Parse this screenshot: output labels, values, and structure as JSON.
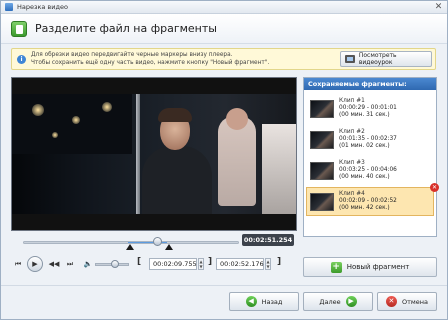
{
  "window": {
    "title": "Нарезка видео",
    "close_glyph": "✕"
  },
  "header": {
    "title": "Разделите файл на фрагменты"
  },
  "hint": {
    "line1": "Для обрезки видео передвигайте черные маркеры внизу плеера.",
    "line2": "Чтобы сохранить ещё одну часть видео, нажмите кнопку \"Новый фрагмент\".",
    "tutorial_label": "Посмотреть видеоурок"
  },
  "player": {
    "current_time": "00:02:51.254",
    "progress": 0.62,
    "start_field": "00:02:09.755",
    "end_field": "00:02:52.176",
    "volume": 0.6
  },
  "clips": {
    "header": "Сохраняемые фрагменты:",
    "items": [
      {
        "name": "Клип #1",
        "range": "00:00:29 - 00:01:01",
        "duration": "(00 мин. 31 сек.)",
        "active": false
      },
      {
        "name": "Клип #2",
        "range": "00:01:35 - 00:02:37",
        "duration": "(01 мин. 02 сек.)",
        "active": false
      },
      {
        "name": "Клип #3",
        "range": "00:03:25 - 00:04:06",
        "duration": "(00 мин. 40 сек.)",
        "active": false
      },
      {
        "name": "Клип #4",
        "range": "00:02:09 - 00:02:52",
        "duration": "(00 мин. 42 сек.)",
        "active": true
      }
    ],
    "new_clip_label": "Новый фрагмент"
  },
  "footer": {
    "back_label": "Назад",
    "next_label": "Далее",
    "cancel_label": "Отмена"
  },
  "colors": {
    "accent": "#2f69b1",
    "active_clip": "#fde6b0",
    "delete": "#d8302a"
  }
}
